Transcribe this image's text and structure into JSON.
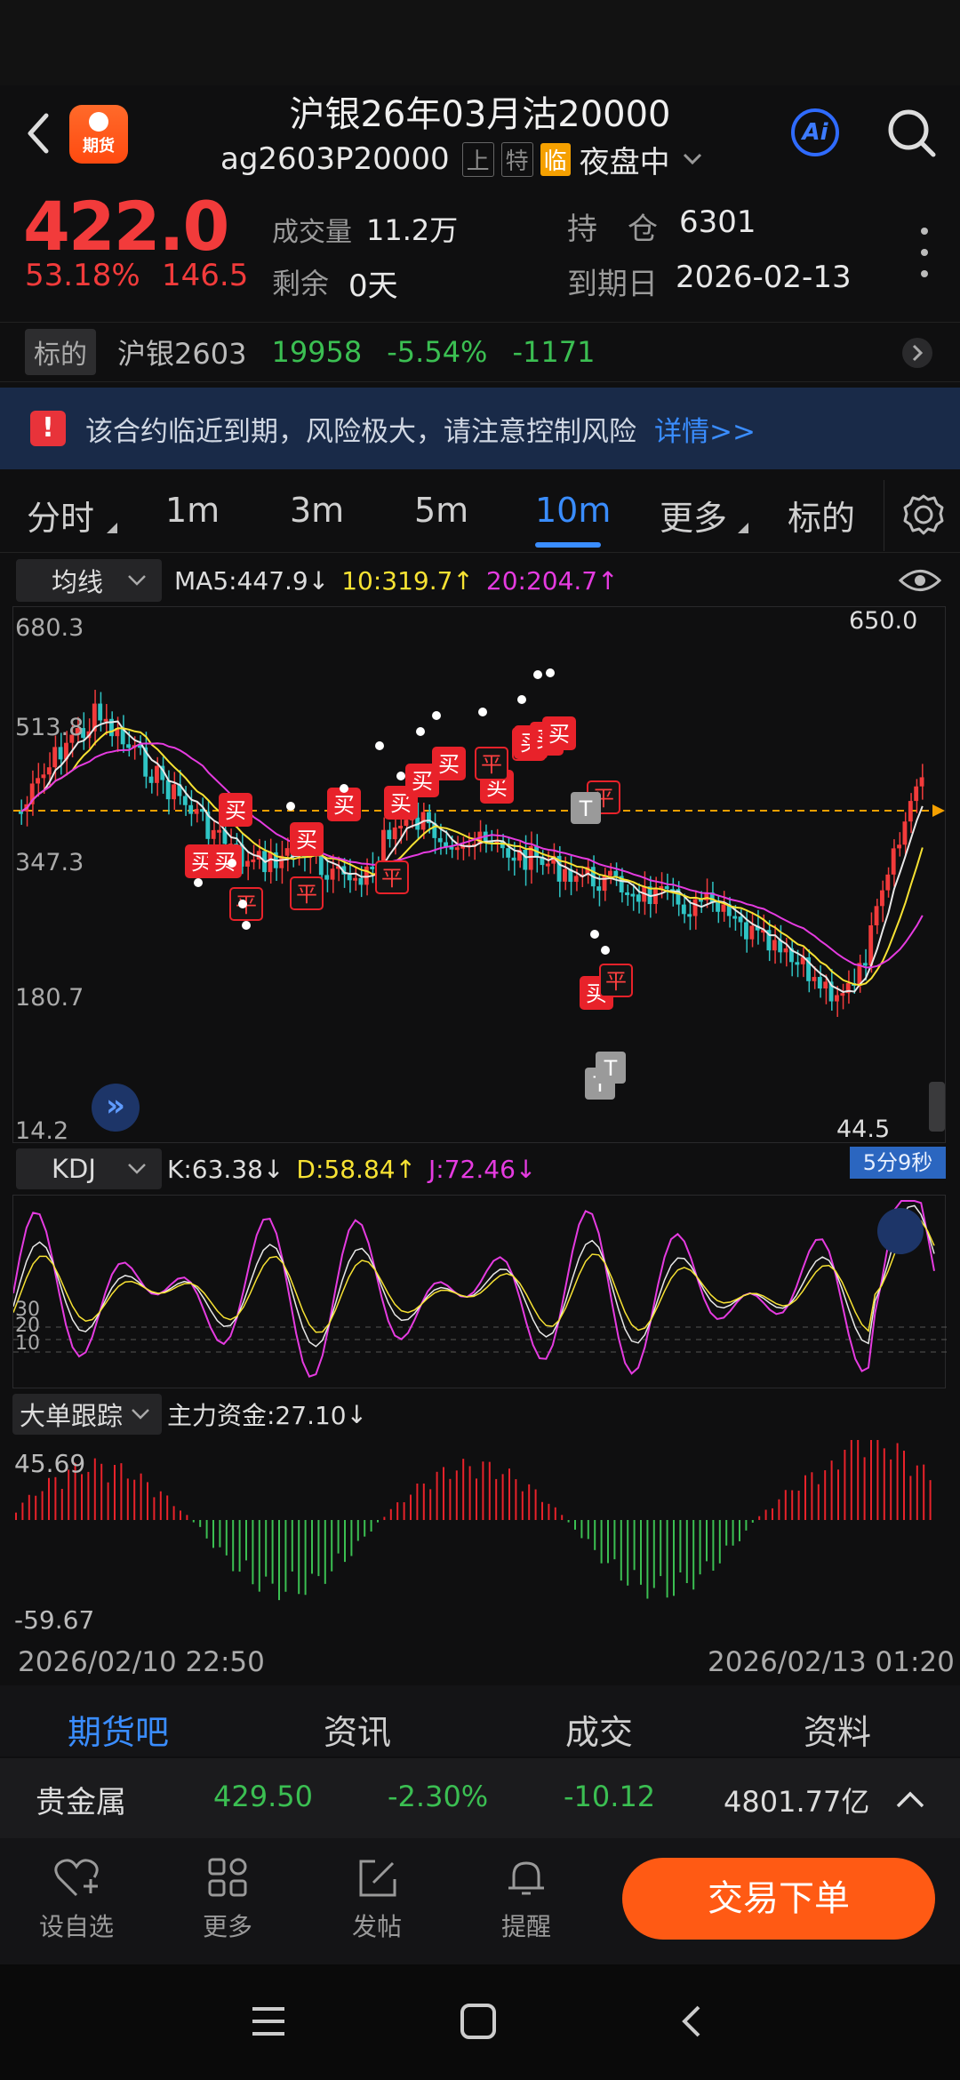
{
  "header": {
    "title": "沪银26年03月沽20000",
    "logo_text": "期货",
    "code": "ag2603P20000",
    "tag_shang": "上",
    "tag_te": "特",
    "tag_lin": "临",
    "session": "夜盘中",
    "ai_label": "Ai"
  },
  "quote": {
    "price": "422.0",
    "change_pct": "53.18%",
    "change_val": "146.5",
    "volume_label": "成交量",
    "volume": "11.2万",
    "remaining_label": "剩余",
    "remaining": "0天",
    "position_label": "持　仓",
    "position": "6301",
    "expiry_label": "到期日",
    "expiry": "2026-02-13"
  },
  "underlying": {
    "tag": "标的",
    "name": "沪银2603",
    "price": "19958",
    "pct": "-5.54%",
    "change": "-1171"
  },
  "warning": {
    "icon": "!",
    "text": "该合约临近到期，风险极大，请注意控制风险",
    "link": "详情>>"
  },
  "periods": {
    "tabs": [
      "分时",
      "1m",
      "3m",
      "5m",
      "10m",
      "更多",
      "标的"
    ],
    "active_index": 4
  },
  "ma": {
    "selector": "均线",
    "ma5": "MA5:447.9",
    "ma10": "10:319.7",
    "ma20": "20:204.7"
  },
  "main_chart": {
    "y_labels": [
      "680.3",
      "513.8",
      "347.3",
      "180.7",
      "14.2"
    ],
    "max_label": "650.0",
    "min_label": "44.5",
    "countdown": "5分9秒",
    "buy_label": "买",
    "close_label": "平",
    "t_label": "T"
  },
  "kdj": {
    "selector": "KDJ",
    "k": "K:63.38",
    "d": "D:58.84",
    "j": "J:72.46",
    "levels": [
      "30",
      "20",
      "10"
    ]
  },
  "flow": {
    "selector": "大单跟踪",
    "label": "主力资金:27.10",
    "max": "45.69",
    "min": "-59.67"
  },
  "dates": {
    "start": "2026/02/10 22:50",
    "end": "2026/02/13 01:20"
  },
  "tabs_bottom": [
    "期货吧",
    "资讯",
    "成交",
    "资料"
  ],
  "sector": {
    "name": "贵金属",
    "price": "429.50",
    "pct": "-2.30%",
    "change": "-10.12",
    "amount": "4801.77亿"
  },
  "toolbar": {
    "items": [
      "设自选",
      "更多",
      "发帖",
      "提醒"
    ],
    "trade": "交易下单"
  },
  "colors": {
    "up": "#f23b3b",
    "down": "#3bbf52",
    "accent": "#3a8dff",
    "trade": "#ff5a14"
  }
}
